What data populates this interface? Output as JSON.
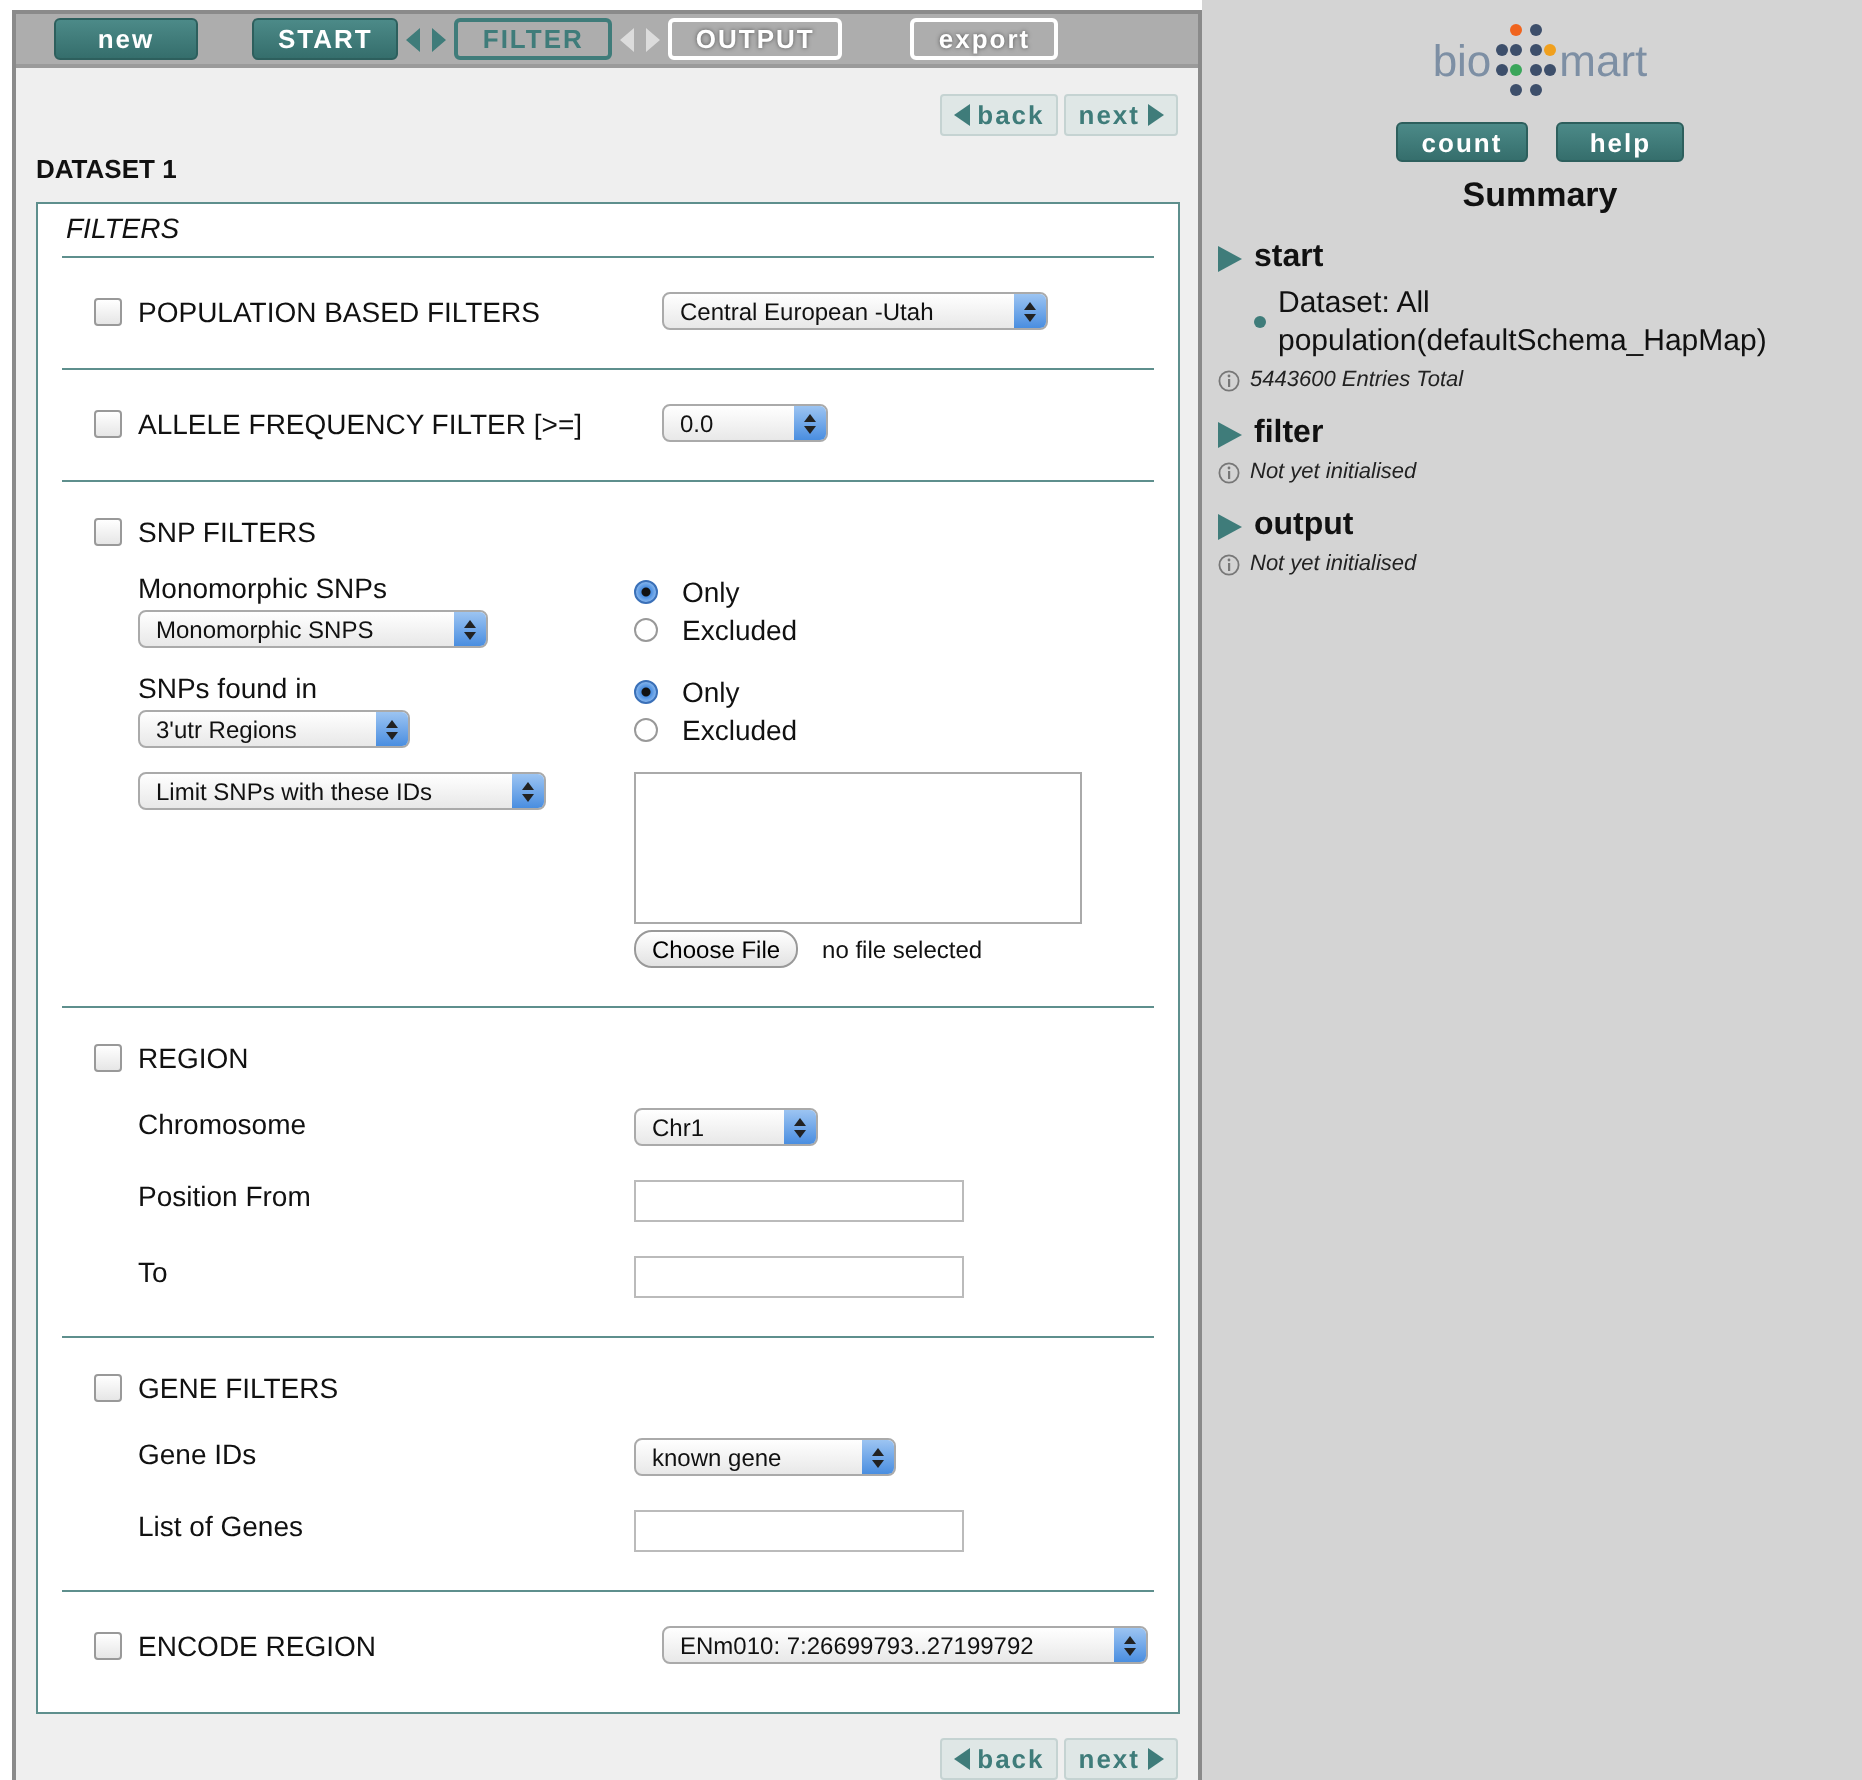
{
  "toolbar": {
    "new_button": {
      "label": "new"
    },
    "steps": [
      {
        "label": "START",
        "selected": false,
        "disabled": false
      },
      {
        "label": "FILTER",
        "selected": true,
        "disabled": false
      },
      {
        "label": "OUTPUT",
        "selected": false,
        "disabled": true
      }
    ],
    "export_button": {
      "label": "export",
      "disabled": true
    }
  },
  "pager_top": {
    "back": "back",
    "next": "next"
  },
  "dataset_title": "DATASET 1",
  "filters": {
    "title": "FILTERS",
    "sections": [
      {
        "label": "POPULATION BASED FILTERS",
        "checked": false,
        "select": {
          "value": "Central European -Utah"
        }
      },
      {
        "label": "ALLELE FREQUENCY FILTER [>=]",
        "checked": false,
        "select": {
          "value": "0.0"
        }
      },
      {
        "label": "SNP FILTERS",
        "checked": false,
        "rows": [
          {
            "kind": "select_radio",
            "label": "Monomorphic SNPs",
            "select": {
              "value": "Monomorphic SNPS"
            },
            "radios": [
              {
                "label": "Only",
                "selected": true
              },
              {
                "label": "Excluded",
                "selected": false
              }
            ]
          },
          {
            "kind": "select_radio",
            "label": "SNPs found in",
            "select": {
              "value": "3'utr Regions"
            },
            "radios": [
              {
                "label": "Only",
                "selected": true
              },
              {
                "label": "Excluded",
                "selected": false
              }
            ]
          },
          {
            "kind": "id_list",
            "select": {
              "value": "Limit SNPs with these IDs"
            },
            "button": "Choose File",
            "file_status": "no file selected"
          }
        ]
      },
      {
        "label": "REGION",
        "checked": false,
        "rows": [
          {
            "kind": "select",
            "label": "Chromosome",
            "select": {
              "value": "Chr1"
            }
          },
          {
            "kind": "text",
            "label": "Position From"
          },
          {
            "kind": "text",
            "label": "To"
          }
        ]
      },
      {
        "label": "GENE FILTERS",
        "checked": false,
        "rows": [
          {
            "kind": "select",
            "label": "Gene IDs",
            "select": {
              "value": "known gene"
            }
          },
          {
            "kind": "text",
            "label": "List of Genes"
          }
        ]
      },
      {
        "label": "ENCODE REGION",
        "checked": false,
        "select": {
          "value": "ENm010: 7:26699793..27199792"
        }
      }
    ]
  },
  "pager_bottom": {
    "back": "back",
    "next": "next"
  },
  "sidebar": {
    "logo": {
      "left": "bio",
      "right": "mart"
    },
    "buttons": [
      "count",
      "help"
    ],
    "title": "Summary",
    "groups": [
      {
        "title": "start",
        "items": [
          "Dataset: All population(defaultSchema_HapMap)"
        ],
        "info": "5443600 Entries Total"
      },
      {
        "title": "filter",
        "info": "Not yet initialised"
      },
      {
        "title": "output",
        "info": "Not yet initialised"
      }
    ]
  }
}
